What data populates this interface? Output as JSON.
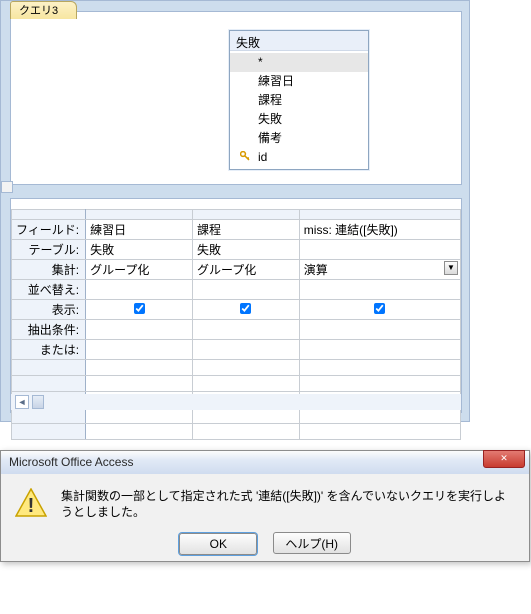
{
  "tab": {
    "title": "クエリ3"
  },
  "fieldlist": {
    "title": "失敗",
    "star": "*",
    "items": [
      "練習日",
      "課程",
      "失敗",
      "備考",
      "id"
    ]
  },
  "grid": {
    "row_labels": {
      "field": "フィールド:",
      "table": "テーブル:",
      "total": "集計:",
      "sort": "並べ替え:",
      "show": "表示:",
      "criteria": "抽出条件:",
      "or": "または:"
    },
    "cols": [
      {
        "field": "練習日",
        "table": "失敗",
        "total": "グループ化",
        "show": true
      },
      {
        "field": "課程",
        "table": "失敗",
        "total": "グループ化",
        "show": true
      },
      {
        "field": "miss: 連結([失敗])",
        "table": "",
        "total": "演算",
        "show": true,
        "has_dropdown": true
      }
    ]
  },
  "dialog": {
    "title": "Microsoft Office Access",
    "close_glyph": "✕",
    "message": "集計関数の一部として指定された式 '連結([失敗])' を含んでいないクエリを実行しようとしました。",
    "ok": "OK",
    "help": "ヘルプ(H)"
  }
}
